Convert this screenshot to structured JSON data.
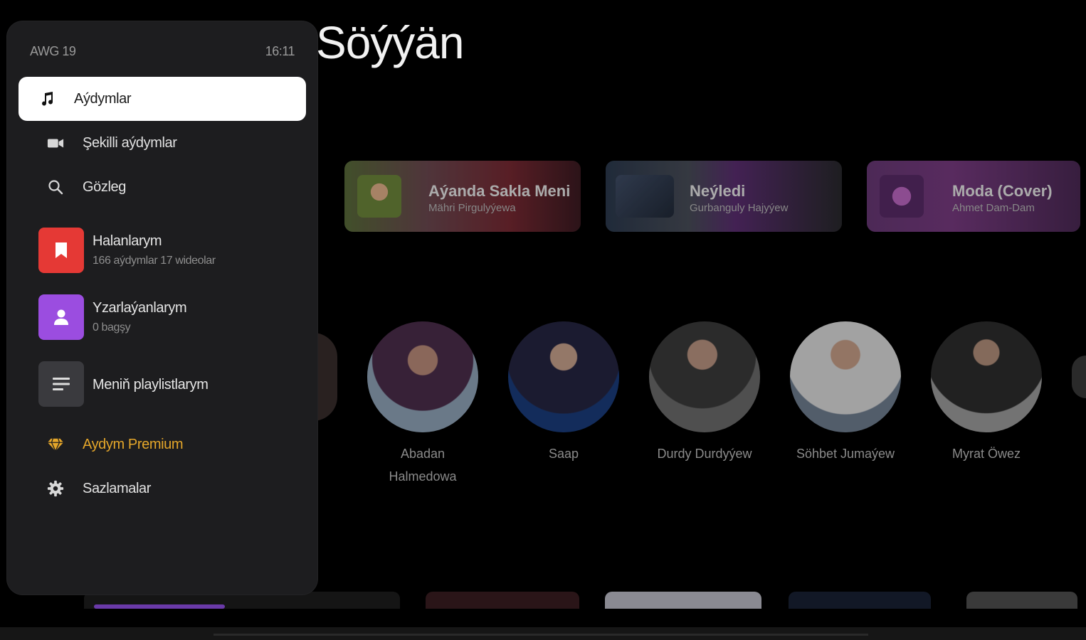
{
  "page": {
    "title": "Söýýän"
  },
  "status": {
    "date": "AWG 19",
    "time": "16:11"
  },
  "nav": {
    "songs": {
      "label": "Aýdymlar",
      "icon": "music-note-icon"
    },
    "videos": {
      "label": "Şekilli aýdymlar",
      "icon": "video-camera-icon"
    },
    "search": {
      "label": "Gözleg",
      "icon": "search-icon"
    },
    "premium": {
      "label": "Aydym Premium",
      "icon": "diamond-icon",
      "color": "#e4a62a"
    },
    "settings": {
      "label": "Sazlamalar",
      "icon": "gear-icon"
    }
  },
  "library": {
    "favorites": {
      "title": "Halanlarym",
      "subtitle": "166 aýdymlar 17 wideolar",
      "icon": "bookmark-icon",
      "color": "#e53935"
    },
    "following": {
      "title": "Yzarlaýanlarym",
      "subtitle": "0 bagşy",
      "icon": "user-icon",
      "color": "#9b4de0"
    },
    "playlists": {
      "title": "Meniň playlistlarym",
      "icon": "playlist-icon",
      "color": "#3a3a3e"
    }
  },
  "featured": [
    {
      "title": "Aýanda Sakla Meni",
      "artist": "Mähri Pirgulyýewa"
    },
    {
      "title": "Neýledi",
      "artist": "Gurbanguly Hajyýew"
    },
    {
      "title": "Moda (Cover)",
      "artist": "Ahmet Dam-Dam"
    }
  ],
  "artists": [
    {
      "name": "Abadan Halmedowa"
    },
    {
      "name": "Saap"
    },
    {
      "name": "Durdy Durdyýew"
    },
    {
      "name": "Söhbet Jumaýew"
    },
    {
      "name": "Myrat Öwez"
    }
  ]
}
